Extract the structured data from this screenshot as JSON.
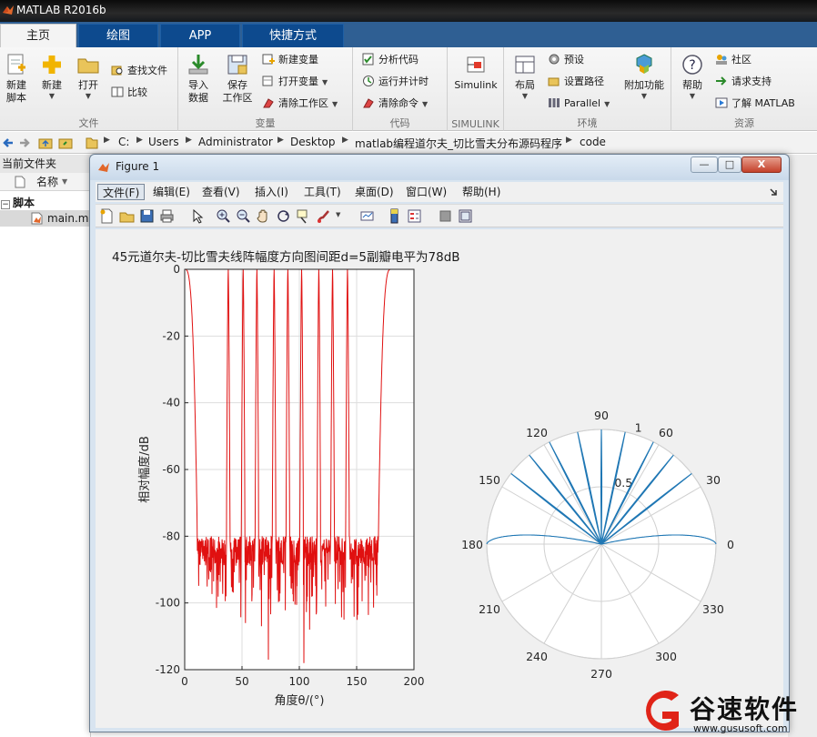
{
  "app": {
    "title": "MATLAB R2016b"
  },
  "tabs": [
    {
      "label": "主页",
      "active": true
    },
    {
      "label": "绘图",
      "active": false
    },
    {
      "label": "APP",
      "active": false
    },
    {
      "label": "快捷方式",
      "active": false
    }
  ],
  "ribbon": {
    "file": {
      "label": "文件",
      "new_script": "新建\n脚本",
      "new": "新建",
      "open": "打开",
      "find_files": "查找文件",
      "compare": "比较"
    },
    "variable": {
      "label": "变量",
      "import_data": "导入\n数据",
      "save_workspace": "保存\n工作区",
      "new_variable": "新建变量",
      "open_variable": "打开变量",
      "clear_workspace": "清除工作区"
    },
    "code": {
      "label": "代码",
      "analyze_code": "分析代码",
      "run_and_time": "运行并计时",
      "clear_commands": "清除命令"
    },
    "simulink": {
      "label": "SIMULINK",
      "button": "Simulink"
    },
    "environment": {
      "label": "环境",
      "layout": "布局",
      "preferences": "预设",
      "set_path": "设置路径",
      "parallel": "Parallel",
      "addons": "附加功能"
    },
    "resources": {
      "label": "资源",
      "help": "帮助",
      "community": "社区",
      "request_support": "请求支持",
      "learn_matlab": "了解 MATLAB"
    }
  },
  "address": {
    "crumbs": [
      "C:",
      "Users",
      "Administrator",
      "Desktop",
      "matlab编程道尔夫_切比雪夫分布源码程序",
      "code"
    ]
  },
  "current_folder": {
    "title": "当前文件夹",
    "column_name": "名称",
    "folder_label": "脚本",
    "file_name": "main.m"
  },
  "figure": {
    "window_title": "Figure 1",
    "menus": [
      "文件(F)",
      "编辑(E)",
      "查看(V)",
      "插入(I)",
      "工具(T)",
      "桌面(D)",
      "窗口(W)",
      "帮助(H)"
    ],
    "window_buttons": {
      "minimize": "—",
      "maximize": "□",
      "close": "X"
    }
  },
  "chart_data": [
    {
      "type": "line",
      "title": "45元道尔夫-切比雪夫线阵幅度方向图间距d=5副瓣电平为78dB",
      "xlabel": "角度θ/(°)",
      "ylabel": "相对幅度/dB",
      "xlim": [
        0,
        200
      ],
      "ylim": [
        -120,
        0
      ],
      "xticks": [
        0,
        50,
        100,
        150,
        200
      ],
      "yticks": [
        -120,
        -100,
        -80,
        -60,
        -40,
        -20,
        0
      ],
      "grid": true,
      "line_color": "#e01010",
      "main_lobes": [
        0,
        38,
        51,
        63,
        78,
        90,
        102,
        117,
        129,
        142,
        180
      ],
      "sidelobe_level": -78
    },
    {
      "type": "polar",
      "r_ticks": [
        0.5,
        1
      ],
      "r_tick_labels": [
        "0.5",
        "1"
      ],
      "theta_ticks": [
        0,
        30,
        60,
        90,
        120,
        150,
        180,
        210,
        240,
        270,
        300,
        330
      ],
      "theta_tick_labels": [
        "0",
        "30",
        "60",
        "90",
        "120",
        "150",
        "180",
        "210",
        "240",
        "270",
        "300",
        "330"
      ],
      "line_color": "#1f77b4",
      "lobe_angles": [
        0,
        38,
        51,
        63,
        78,
        90,
        102,
        117,
        129,
        142,
        180
      ],
      "lobe_amplitudes": [
        1,
        1,
        1,
        1,
        1,
        1,
        1,
        1,
        1,
        1,
        1
      ]
    }
  ],
  "watermark": {
    "text": "谷速软件",
    "url": "www.gususoft.com"
  }
}
